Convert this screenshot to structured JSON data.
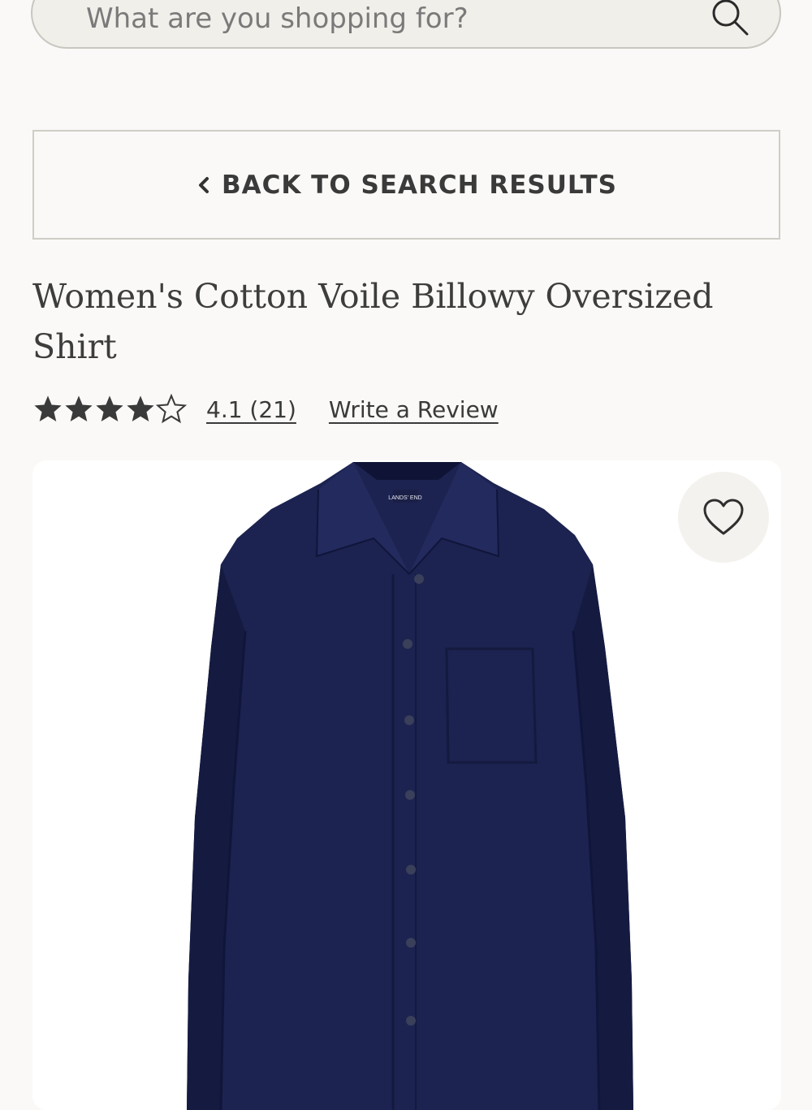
{
  "search": {
    "placeholder": "What are you shopping for?"
  },
  "back_button": {
    "label": "BACK TO SEARCH RESULTS"
  },
  "product": {
    "title": "Women's Cotton Voile Billowy Oversized Shirt",
    "rating": {
      "stars": 4.1,
      "max": 5,
      "label": "4.1 (21)"
    },
    "write_review": "Write a Review",
    "brand_tag": "LANDS' END",
    "image": {
      "color": "#1c2350"
    }
  },
  "icons": {
    "search": "search-icon",
    "back": "chevron-left-icon",
    "favorite": "heart-outline-icon",
    "star": "star-icon"
  },
  "colors": {
    "background": "#faf9f7",
    "text": "#3b3b3b",
    "border": "#d0cdc6"
  }
}
